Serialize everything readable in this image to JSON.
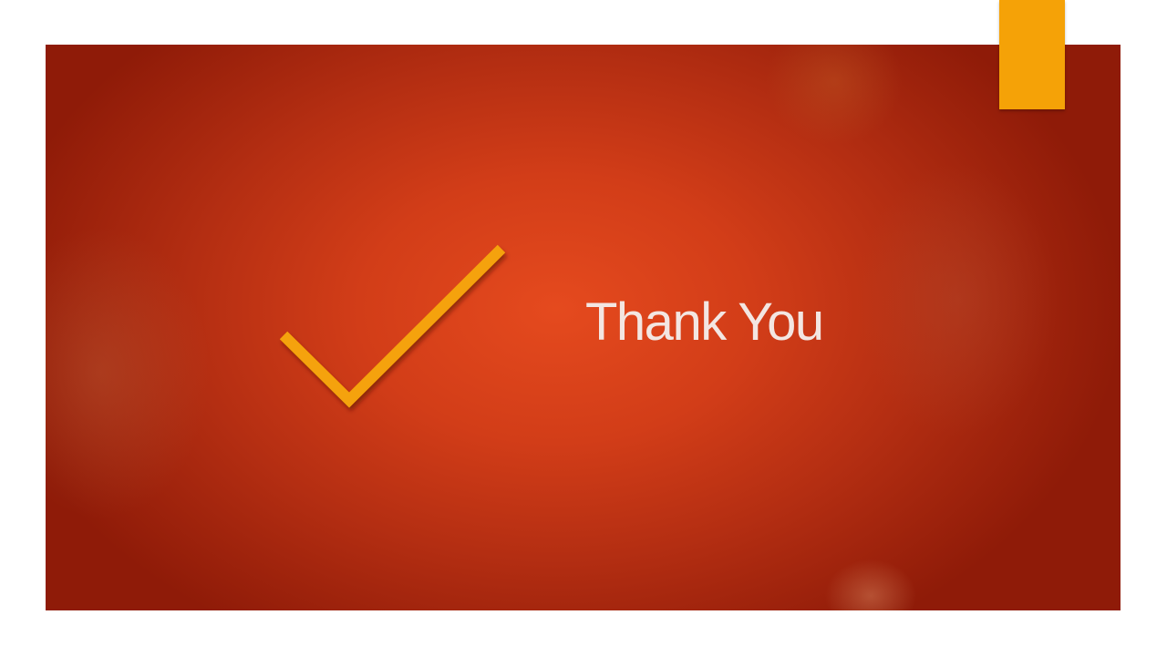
{
  "slide": {
    "title": "Thank You",
    "icon": "checkmark-icon",
    "accent_color": "#f5a207",
    "background_color": "#d23d18",
    "title_color": "#f3e6e2"
  }
}
